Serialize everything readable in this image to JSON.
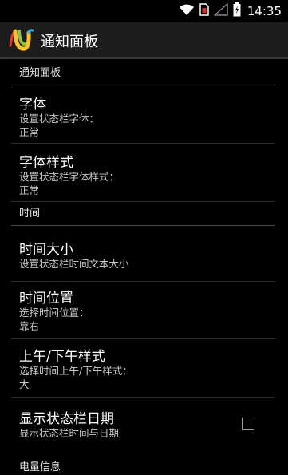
{
  "status_bar": {
    "time": "14:35",
    "icons": [
      "wifi-icon",
      "sim-card-icon",
      "signal-icon",
      "battery-icon"
    ]
  },
  "action_bar": {
    "title": "通知面板",
    "logo": "app-logo-icon"
  },
  "sections": [
    {
      "header": "通知面板",
      "items": [
        {
          "title": "字体",
          "summary": "设置状态栏字体：",
          "value": "正常"
        },
        {
          "title": "字体样式",
          "summary": "设置状态栏字体样式：",
          "value": "正常"
        }
      ]
    },
    {
      "header": "时间",
      "items": [
        {
          "title": "时间大小",
          "summary": "设置状态栏时间文本大小"
        },
        {
          "title": "时间位置",
          "summary": "选择时间位置：",
          "value": "靠右"
        },
        {
          "title": "上午/下午样式",
          "summary": "选择时间上午/下午样式：",
          "value": "大"
        },
        {
          "title": "显示状态栏日期",
          "summary": "显示状态栏时间与日期",
          "checked": false
        }
      ]
    },
    {
      "header": "电量信息",
      "items": []
    }
  ],
  "colors": {
    "background": "#000000",
    "action_bar": "#1c1c1c",
    "divider": "#4a4a4a"
  }
}
